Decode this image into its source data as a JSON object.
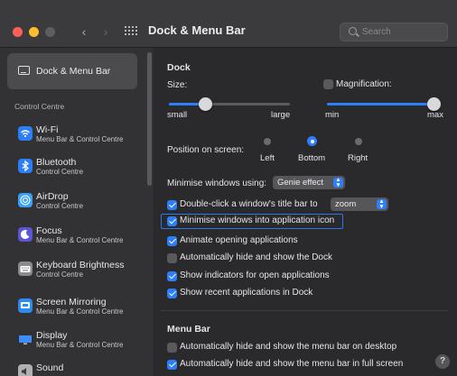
{
  "window": {
    "title": "Dock & Menu Bar"
  },
  "search": {
    "placeholder": "Search"
  },
  "sidebar": {
    "selected": {
      "title": "Dock & Menu Bar"
    },
    "section_label": "Control Centre",
    "items": [
      {
        "title": "Wi-Fi",
        "subtitle": "Menu Bar & Control Centre",
        "icon": "wifi-icon"
      },
      {
        "title": "Bluetooth",
        "subtitle": "Control Centre",
        "icon": "bluetooth-icon"
      },
      {
        "title": "AirDrop",
        "subtitle": "Control Centre",
        "icon": "airdrop-icon"
      },
      {
        "title": "Focus",
        "subtitle": "Menu Bar & Control Centre",
        "icon": "focus-moon-icon"
      },
      {
        "title": "Keyboard Brightness",
        "subtitle": "Control Centre",
        "icon": "keyboard-icon"
      },
      {
        "title": "Screen Mirroring",
        "subtitle": "Menu Bar & Control Centre",
        "icon": "screen-mirroring-icon"
      },
      {
        "title": "Display",
        "subtitle": "Menu Bar & Control Centre",
        "icon": "display-icon"
      },
      {
        "title": "Sound",
        "subtitle": "",
        "icon": "sound-icon"
      }
    ]
  },
  "dock": {
    "heading": "Dock",
    "size_label": "Size:",
    "size_min_label": "small",
    "size_max_label": "large",
    "size_value": 0.3,
    "magnification": {
      "label": "Magnification:",
      "checked": false,
      "min_label": "min",
      "max_label": "max",
      "value": 1.0
    },
    "position": {
      "label": "Position on screen:",
      "options": [
        "Left",
        "Bottom",
        "Right"
      ],
      "selected": "Bottom"
    },
    "minimise_using": {
      "label": "Minimise windows using:",
      "value": "Genie effect"
    },
    "double_click": {
      "label": "Double-click a window's title bar to",
      "value": "zoom",
      "checked": true
    },
    "options": [
      {
        "label": "Minimise windows into application icon",
        "checked": true
      },
      {
        "label": "Animate opening applications",
        "checked": true
      },
      {
        "label": "Automatically hide and show the Dock",
        "checked": false
      },
      {
        "label": "Show indicators for open applications",
        "checked": true
      },
      {
        "label": "Show recent applications in Dock",
        "checked": true
      }
    ]
  },
  "menu_bar": {
    "heading": "Menu Bar",
    "options": [
      {
        "label": "Automatically hide and show the menu bar on desktop",
        "checked": false
      },
      {
        "label": "Automatically hide and show the menu bar in full screen",
        "checked": true
      }
    ]
  },
  "help": {
    "label": "?"
  },
  "colors": {
    "accent": "#2d7ff9",
    "sidebar_bg": "#323235",
    "main_bg": "#2a2a2d"
  }
}
